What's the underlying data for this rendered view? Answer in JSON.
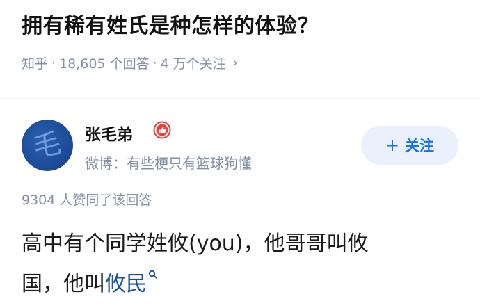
{
  "question": {
    "title": "拥有稀有姓氏是种怎样的体验？",
    "source": "知乎",
    "answers_count": "18,605 个回答",
    "followers_count": "4 万个关注",
    "separator": "·",
    "chevron": "›"
  },
  "author": {
    "name": "张毛弟",
    "bio": "微博：有些梗只有篮球狗懂",
    "avatar_glyph": "毛",
    "badge_icon": "thumbs-up-badge-icon"
  },
  "follow_button": {
    "plus": "+",
    "label": "关注"
  },
  "answer": {
    "vote_summary": "9304 人赞同了该回答",
    "line1": "高中有个同学姓攸(you)，他哥哥叫攸",
    "line2_prefix": "国，他叫",
    "line2_link": "攸民"
  },
  "colors": {
    "accent": "#1772f6",
    "muted": "#8590a6",
    "link": "#175199",
    "badge": "#f1403c",
    "follow_bg": "#eaf1fd"
  }
}
